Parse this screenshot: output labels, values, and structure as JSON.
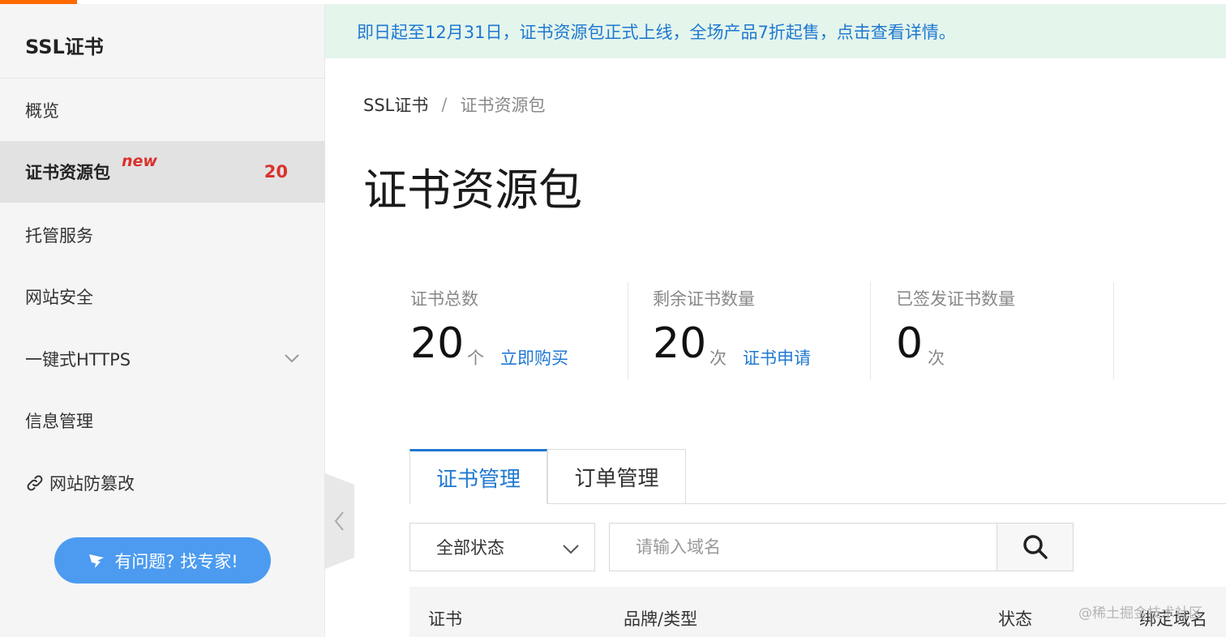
{
  "sidebar": {
    "title": "SSL证书",
    "items": [
      {
        "label": "概览"
      },
      {
        "label": "证书资源包",
        "tag": "new",
        "count": "20"
      },
      {
        "label": "托管服务"
      },
      {
        "label": "网站安全"
      },
      {
        "label": "一键式HTTPS"
      },
      {
        "label": "信息管理"
      },
      {
        "label": "网站防篡改"
      }
    ],
    "help_button": "有问题? 找专家!"
  },
  "banner": {
    "text": "即日起至12月31日，证书资源包正式上线，全场产品7折起售，点击查看详情。"
  },
  "breadcrumb": {
    "root": "SSL证书",
    "separator": "/",
    "current": "证书资源包"
  },
  "page_title": "证书资源包",
  "stats": [
    {
      "label": "证书总数",
      "value": "20",
      "unit": "个",
      "link": "立即购买"
    },
    {
      "label": "剩余证书数量",
      "value": "20",
      "unit": "次",
      "link": "证书申请"
    },
    {
      "label": "已签发证书数量",
      "value": "0",
      "unit": "次"
    }
  ],
  "tabs": [
    {
      "label": "证书管理"
    },
    {
      "label": "订单管理"
    }
  ],
  "filter": {
    "status_select": "全部状态",
    "search_placeholder": "请输入域名"
  },
  "table": {
    "columns": [
      "证书",
      "品牌/类型",
      "状态",
      "绑定域名"
    ]
  },
  "watermark": "@稀土掘金技术社区",
  "colors": {
    "accent": "#1f78d1",
    "brand_orange": "#ff6a00",
    "badge_red": "#d9322b",
    "help_blue": "#4c9bf0",
    "banner_bg": "#e4f5ec"
  }
}
